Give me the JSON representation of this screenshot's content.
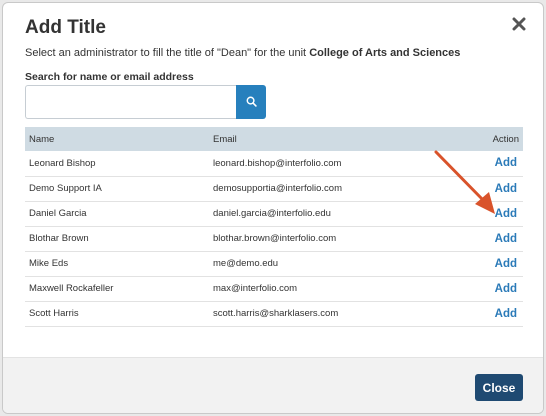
{
  "dialog": {
    "title": "Add Title",
    "instruction_prefix": "Select an administrator to fill the title of \"Dean\" for the unit ",
    "instruction_unit": "College of Arts and Sciences",
    "close_button_label": "Close"
  },
  "search": {
    "label": "Search for name or email address",
    "value": "",
    "placeholder": ""
  },
  "table": {
    "headers": {
      "name": "Name",
      "email": "Email",
      "action": "Action"
    },
    "rows": [
      {
        "name": "Leonard Bishop",
        "email": "leonard.bishop@interfolio.com",
        "action": "Add"
      },
      {
        "name": "Demo Support IA",
        "email": "demosupportia@interfolio.com",
        "action": "Add"
      },
      {
        "name": "Daniel Garcia",
        "email": "daniel.garcia@interfolio.edu",
        "action": "Add"
      },
      {
        "name": "Blothar Brown",
        "email": "blothar.brown@interfolio.com",
        "action": "Add"
      },
      {
        "name": "Mike Eds",
        "email": "me@demo.edu",
        "action": "Add"
      },
      {
        "name": "Maxwell Rockafeller",
        "email": "max@interfolio.com",
        "action": "Add"
      },
      {
        "name": "Scott Harris",
        "email": "scott.harris@sharklasers.com",
        "action": "Add"
      }
    ]
  },
  "colors": {
    "accent": "#2780bd",
    "link": "#2a7ab8",
    "close_button": "#1f4a72",
    "table_header": "#cfdbe3",
    "annotation_arrow": "#d9532b"
  },
  "icons": {
    "close": "close-x-icon",
    "search": "search-icon",
    "annotation": "arrow-icon"
  }
}
